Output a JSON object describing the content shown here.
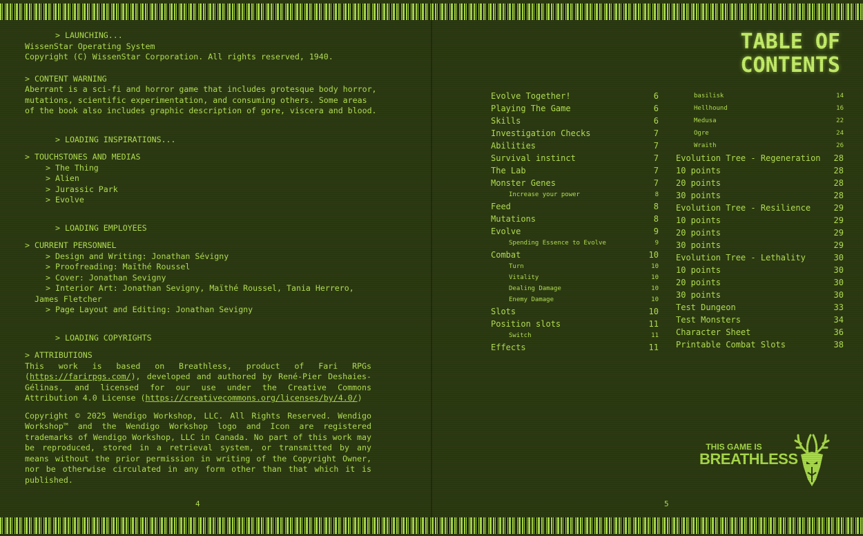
{
  "left": {
    "launching": "> LAUNCHING...",
    "os": "WissenStar Operating System",
    "copyright_line": "Copyright (C) WissenStar Corporation. All rights reserved, 1940.",
    "cw_head": "> CONTENT WARNING",
    "cw_lines": [
      "Aberrant is a sci-fi and horror game that includes grotesque body horror,",
      "mutations, scientific experimentation, and consuming others. Some areas",
      "of the book also includes graphic description of gore, viscera and blood."
    ],
    "loading_inspirations": "> LOADING INSPIRATIONS...",
    "touchstones_head": "> TOUCHSTONES AND MEDIAS",
    "touchstones": [
      "> The Thing",
      "> Alien",
      "> Jurassic Park",
      "> Evolve"
    ],
    "loading_employees": "> LOADING EMPLOYEES",
    "personnel_head": "> CURRENT PERSONNEL",
    "personnel": [
      "> Design and Writing: Jonathan Sévigny",
      "> Proofreading: Maïthé Roussel",
      "> Cover: Jonathan Sevigny",
      "> Interior Art: Jonathan Sevigny, Maïthé Roussel, Tania Herrero,"
    ],
    "personnel_cont": "James Fletcher",
    "personnel_last": "> Page Layout and Editing: Jonathan Sevigny",
    "loading_copyrights": "> LOADING COPYRIGHTS",
    "attributions_head": "> ATTRIBUTIONS",
    "attr_pre": "This work is based on Breathless, product of Fari RPGs (",
    "attr_link1": "https://farirpgs.com/",
    "attr_mid": "), developed and authored by René-Pier Deshaies-Gélinas, and licensed for our use under the Creative Commons Attribution 4.0 License (",
    "attr_link2": "https://creativecommons.org/licenses/by/4.0/",
    "attr_post": ")",
    "copyright_para": "Copyright © 2025 Wendigo Workshop, LLC. All Rights Reserved. Wendigo Workshop™ and the Wendigo Workshop logo and Icon are registered trademarks of Wendigo Workshop, LLC in Canada. No part of this work may be reproduced, stored in a retrieval system, or transmitted by any means without the prior permission in writing of the Copyright Owner, nor be otherwise circulated in any form other than that which it is published.",
    "page_number": "4"
  },
  "right": {
    "title_line1": "TABLE OF",
    "title_line2": "CONTENTS",
    "toc_col1": [
      {
        "t": "Evolve Together!",
        "p": "6",
        "sub": false
      },
      {
        "t": "Playing The Game",
        "p": "6",
        "sub": false
      },
      {
        "t": "Skills",
        "p": "6",
        "sub": false
      },
      {
        "t": "Investigation Checks",
        "p": "7",
        "sub": false
      },
      {
        "t": "Abilities",
        "p": "7",
        "sub": false
      },
      {
        "t": "Survival instinct",
        "p": "7",
        "sub": false
      },
      {
        "t": "The Lab",
        "p": "7",
        "sub": false
      },
      {
        "t": "Monster Genes",
        "p": "7",
        "sub": false
      },
      {
        "t": "Increase your power",
        "p": "8",
        "sub": true
      },
      {
        "t": "Feed",
        "p": "8",
        "sub": false
      },
      {
        "t": "Mutations",
        "p": "8",
        "sub": false
      },
      {
        "t": "Evolve",
        "p": "9",
        "sub": false
      },
      {
        "t": "Spending Essence to Evolve",
        "p": "9",
        "sub": true
      },
      {
        "t": "Combat",
        "p": "10",
        "sub": false
      },
      {
        "t": "Turn",
        "p": "10",
        "sub": true
      },
      {
        "t": "Vitality",
        "p": "10",
        "sub": true
      },
      {
        "t": "Dealing Damage",
        "p": "10",
        "sub": true
      },
      {
        "t": "Enemy Damage",
        "p": "10",
        "sub": true
      },
      {
        "t": "Slots",
        "p": "10",
        "sub": false
      },
      {
        "t": "Position slots",
        "p": "11",
        "sub": false
      },
      {
        "t": "Switch",
        "p": "11",
        "sub": true
      },
      {
        "t": "Effects",
        "p": "11",
        "sub": false
      }
    ],
    "toc_col2": [
      {
        "t": "basilisk",
        "p": "14",
        "sub": true
      },
      {
        "t": "Hellhound",
        "p": "16",
        "sub": true
      },
      {
        "t": "Medusa",
        "p": "22",
        "sub": true
      },
      {
        "t": "Ogre",
        "p": "24",
        "sub": true
      },
      {
        "t": "Wraith",
        "p": "26",
        "sub": true
      },
      {
        "t": "Evolution Tree - Regeneration",
        "p": "28",
        "sub": false
      },
      {
        "t": "10 points",
        "p": "28",
        "sub": false
      },
      {
        "t": "20 points",
        "p": "28",
        "sub": false
      },
      {
        "t": "30 points",
        "p": "28",
        "sub": false
      },
      {
        "t": "Evolution Tree - Resilience",
        "p": "29",
        "sub": false
      },
      {
        "t": "10 points",
        "p": "29",
        "sub": false
      },
      {
        "t": "20 points",
        "p": "29",
        "sub": false
      },
      {
        "t": "30 points",
        "p": "29",
        "sub": false
      },
      {
        "t": "Evolution Tree - Lethality",
        "p": "30",
        "sub": false
      },
      {
        "t": "10 points",
        "p": "30",
        "sub": false
      },
      {
        "t": "20 points",
        "p": "30",
        "sub": false
      },
      {
        "t": "30 points",
        "p": "30",
        "sub": false
      },
      {
        "t": "Test Dungeon",
        "p": "33",
        "sub": false
      },
      {
        "t": "Test Monsters",
        "p": "34",
        "sub": false
      },
      {
        "t": "Character Sheet",
        "p": "36",
        "sub": false
      },
      {
        "t": "Printable Combat Slots",
        "p": "38",
        "sub": false
      }
    ],
    "logo_line1": "THIS GAME IS",
    "logo_line2": "BREATHLESS",
    "page_number": "5"
  },
  "colors": {
    "background": "#2c3a12",
    "text": "#b3e052",
    "title": "#c6ef6a"
  },
  "icons": [
    "barcode-strip",
    "wendigo-stag-emblem"
  ]
}
